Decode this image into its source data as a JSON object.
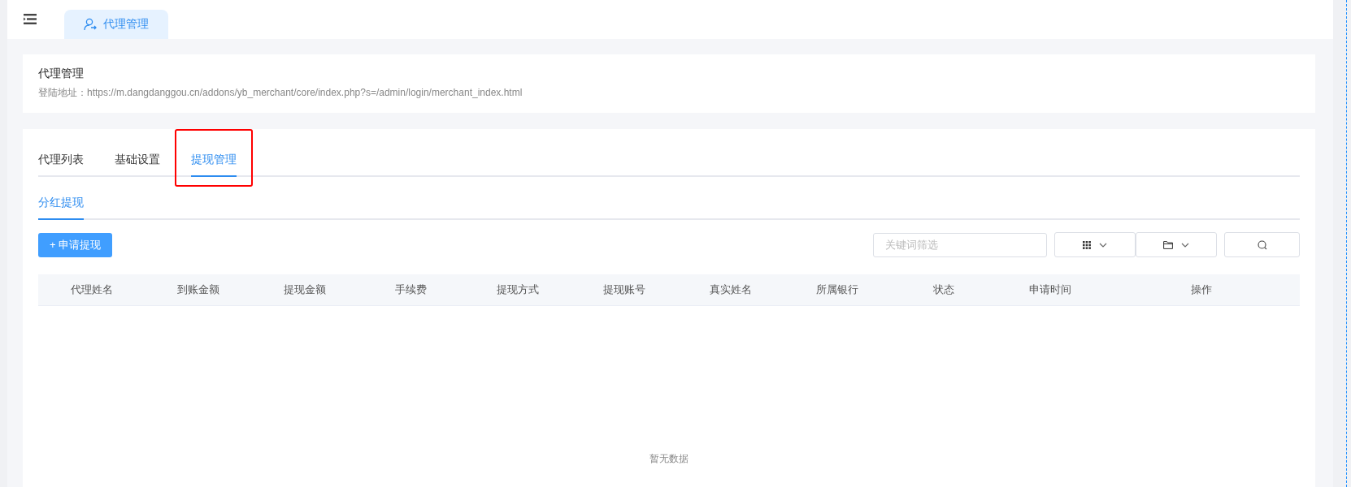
{
  "top_tabs": [
    {
      "label": "代理管理",
      "selected": true
    }
  ],
  "header": {
    "title": "代理管理",
    "url_label": "登陆地址：https://m.dangdanggou.cn/addons/yb_merchant/core/index.php?s=/admin/login/merchant_index.html"
  },
  "tabs": [
    {
      "label": "代理列表",
      "selected": false,
      "highlighted": false
    },
    {
      "label": "基础设置",
      "selected": false,
      "highlighted": false
    },
    {
      "label": "提现管理",
      "selected": true,
      "highlighted": true
    }
  ],
  "sub_tabs": [
    {
      "label": "分红提现",
      "selected": true
    }
  ],
  "toolbar": {
    "add_button": "+ 申请提现",
    "search": {
      "placeholder": "关键词筛选"
    }
  },
  "table": {
    "columns": [
      "代理姓名",
      "到账金额",
      "提现金额",
      "手续费",
      "提现方式",
      "提现账号",
      "真实姓名",
      "所属银行",
      "状态",
      "申请时间",
      "操作"
    ],
    "empty_text": "暂无数据"
  }
}
